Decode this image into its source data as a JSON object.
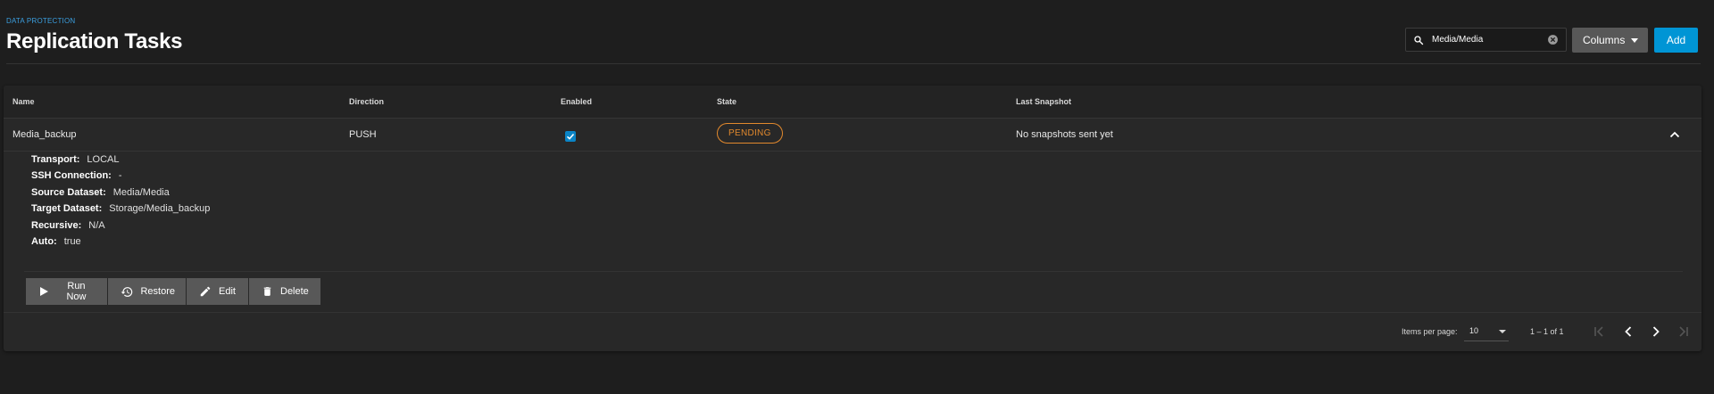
{
  "header": {
    "breadcrumb": "Data Protection",
    "title": "Replication Tasks"
  },
  "toolbar": {
    "search_value": "Media/Media",
    "columns_label": "Columns",
    "add_label": "Add"
  },
  "table": {
    "columns": [
      "Name",
      "Direction",
      "Enabled",
      "State",
      "Last Snapshot"
    ],
    "rows": [
      {
        "name": "Media_backup",
        "direction": "PUSH",
        "enabled": true,
        "state": "PENDING",
        "last_snapshot": "No snapshots sent yet"
      }
    ]
  },
  "details": [
    {
      "label": "Transport:",
      "value": "LOCAL"
    },
    {
      "label": "SSH Connection:",
      "value": "-"
    },
    {
      "label": "Source Dataset:",
      "value": "Media/Media"
    },
    {
      "label": "Target Dataset:",
      "value": "Storage/Media_backup"
    },
    {
      "label": "Recursive:",
      "value": "N/A"
    },
    {
      "label": "Auto:",
      "value": "true"
    }
  ],
  "actions": {
    "run_now": "Run Now",
    "restore": "Restore",
    "edit": "Edit",
    "delete": "Delete"
  },
  "paginator": {
    "items_per_page_label": "Items per page:",
    "items_per_page": "10",
    "range": "1 – 1 of 1"
  },
  "colors": {
    "accent": "#0095d5",
    "state_pending": "#e2892d",
    "background": "#1e1e1e",
    "card": "#282828"
  }
}
